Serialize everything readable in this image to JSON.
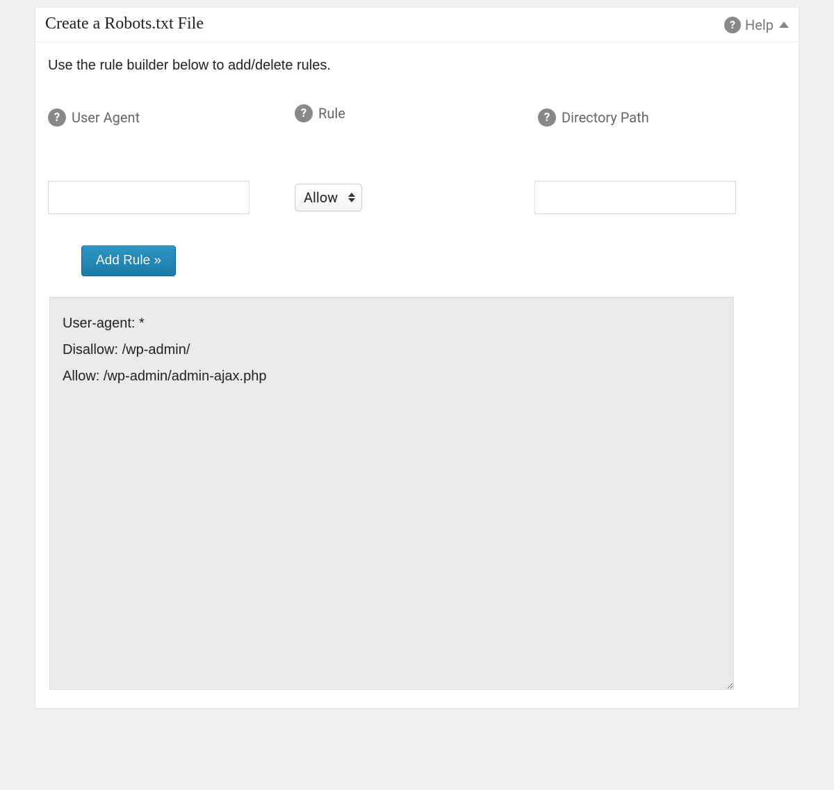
{
  "header": {
    "title": "Create a Robots.txt File",
    "help_label": "Help"
  },
  "body": {
    "instruction": "Use the rule builder below to add/delete rules.",
    "labels": {
      "user_agent": "User Agent",
      "rule": "Rule",
      "directory_path": "Directory Path"
    },
    "inputs": {
      "user_agent_value": "",
      "rule_selected": "Allow",
      "directory_path_value": ""
    },
    "buttons": {
      "add_rule": "Add Rule »"
    },
    "output": "User-agent: *\nDisallow: /wp-admin/\nAllow: /wp-admin/admin-ajax.php"
  }
}
